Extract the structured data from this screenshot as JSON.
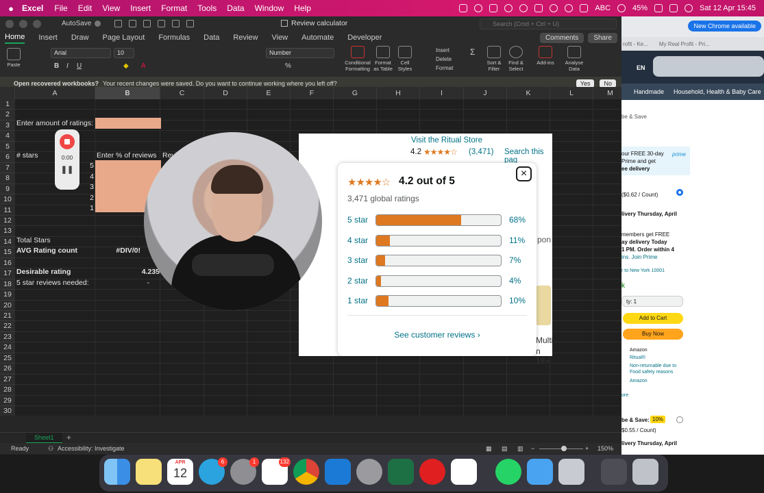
{
  "menubar": {
    "app_name": "Excel",
    "items": [
      "File",
      "Edit",
      "View",
      "Insert",
      "Format",
      "Tools",
      "Data",
      "Window",
      "Help"
    ],
    "input_source": "ABC",
    "battery": "45%",
    "datetime": "Sat 12 Apr  15:45"
  },
  "excel": {
    "autosave_label": "AutoSave",
    "doc_title": "Review calculator",
    "search_placeholder": "Search (Cmd + Ctrl + U)",
    "tabs": [
      "Home",
      "Insert",
      "Draw",
      "Page Layout",
      "Formulas",
      "Data",
      "Review",
      "View",
      "Automate",
      "Developer"
    ],
    "active_tab": "Home",
    "comments_label": "Comments",
    "share_label": "Share",
    "ribbon": {
      "paste": "Paste",
      "font_name": "Arial",
      "font_size": "10",
      "number_format": "Number",
      "conditional_formatting": "Conditional Formatting",
      "format_as_table": "Format as Table",
      "cell_styles": "Cell Styles",
      "insert": "Insert",
      "delete": "Delete",
      "format": "Format",
      "sort_filter": "Sort & Filter",
      "find_select": "Find & Select",
      "addins": "Add-ins",
      "analyse_data": "Analyse Data"
    },
    "infobar": {
      "title": "Open recovered workbooks?",
      "message": "Your recent changes were saved. Do you want to continue working where you left off?",
      "yes": "Yes",
      "no": "No"
    },
    "namebox": "B1",
    "fx": "fx",
    "columns": [
      "A",
      "B",
      "C",
      "D",
      "E",
      "F",
      "G",
      "H",
      "I",
      "J",
      "K",
      "L",
      "M"
    ],
    "rows": [
      "1",
      "2",
      "3",
      "4",
      "5",
      "6",
      "7",
      "8",
      "9",
      "10",
      "11",
      "12",
      "13",
      "14",
      "15",
      "16",
      "17",
      "18",
      "19",
      "20",
      "21",
      "22",
      "23",
      "24",
      "25",
      "26",
      "27",
      "28",
      "29",
      "30"
    ],
    "cells": {
      "a1": "Enter amount of ratings:",
      "a4": "# stars",
      "a5_stars": [
        "5",
        "4",
        "3",
        "2",
        "1"
      ],
      "b4": "Enter % of reviews",
      "c4": "Revi",
      "a12": "Total Stars",
      "a13": "AVG Rating count",
      "b13": "#DIV/0!",
      "a15": "Desirable rating",
      "b15": "4.235",
      "a16": "5 star reviews needed:",
      "b16": "-"
    },
    "sheet_tab": "Sheet1",
    "status": {
      "ready": "Ready",
      "accessibility": "Accessibility: Investigate",
      "zoom": "150%"
    }
  },
  "recorder": {
    "time": "0:00"
  },
  "amazon_page": {
    "visit_store": "Visit the Ritual Store",
    "rating_inline": "4.2",
    "rating_count_inline": "(3,471)",
    "search_page": "Search this pag",
    "popup": {
      "title": "4.2 out of 5",
      "global_ratings": "3,471 global ratings",
      "histogram": [
        {
          "label": "5 star",
          "percent": 68,
          "text": "68%"
        },
        {
          "label": "4 star",
          "percent": 11,
          "text": "11%"
        },
        {
          "label": "3 star",
          "percent": 7,
          "text": "7%"
        },
        {
          "label": "2 star",
          "percent": 4,
          "text": "4%"
        },
        {
          "label": "1 star",
          "percent": 10,
          "text": "10%"
        }
      ],
      "see_reviews": "See customer reviews",
      "close": "×"
    },
    "behind_text_1": "pon",
    "behind_text_2": "Multi",
    "behind_text_3": "n 18+"
  },
  "amazon_side": {
    "chrome_button": "New Chrome available",
    "tab1": "rofit - Ke...",
    "tab2": "My Real Profit - Pri...",
    "lang": "EN",
    "nav1": "Handmade",
    "nav2": "Household, Health & Baby Care",
    "save": "be & Save",
    "prime_1": "our FREE 30-day",
    "prime_2": "Prime and get",
    "prime_3": "ee delivery",
    "prime_logo": "prime",
    "price_per": "($0.62 / Count)",
    "delivery": "livery Thursday, April",
    "members_1": "members get FREE",
    "members_2": "ay delivery Today",
    "members_3": "1 PM. Order within 4",
    "members_4": "ins. Join Prime",
    "location": "r to New York 10001",
    "stock": "k",
    "qty": "ty: 1",
    "add_to_cart": "Add to Cart",
    "buy_now": "Buy Now",
    "seller_1": "Amazon",
    "seller_2": "Ritual®",
    "returns": "Non-returnable due to",
    "returns_2": "Food safety reasons",
    "seller_3": "Amazon",
    "more": "ore",
    "subscribe": "be & Save:",
    "subscribe_pct": "10%",
    "subscribe_price": "$0.55 / Count)",
    "delivery2": "livery Thursday, April"
  },
  "dock": {
    "calendar_month": "APR",
    "calendar_day": "12",
    "telegram_badge": "6",
    "settings_badge": "1",
    "slack_badge": "132"
  }
}
